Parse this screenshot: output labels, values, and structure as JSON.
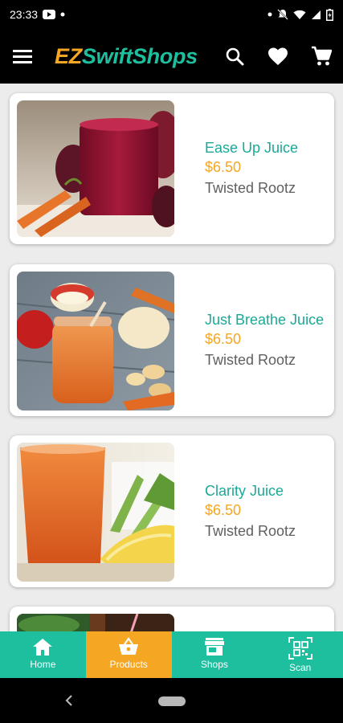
{
  "status_bar": {
    "time": "23:33"
  },
  "app_bar": {
    "brand_prefix": "EZ",
    "brand_suffix": "SwiftShops"
  },
  "products": [
    {
      "name": "Ease Up Juice",
      "price": "$6.50",
      "shop": "Twisted Rootz"
    },
    {
      "name": "Just Breathe Juice",
      "price": "$6.50",
      "shop": "Twisted Rootz"
    },
    {
      "name": "Clarity Juice",
      "price": "$6.50",
      "shop": "Twisted Rootz"
    }
  ],
  "bottom_nav": {
    "items": [
      {
        "label": "Home",
        "icon": "home-icon"
      },
      {
        "label": "Products",
        "icon": "basket-icon",
        "active": true
      },
      {
        "label": "Shops",
        "icon": "store-icon"
      },
      {
        "label": "Scan",
        "icon": "qr-code-icon"
      }
    ]
  },
  "colors": {
    "accent_teal": "#1dbf9f",
    "accent_orange": "#f5a623",
    "app_bar_bg": "#000000"
  }
}
